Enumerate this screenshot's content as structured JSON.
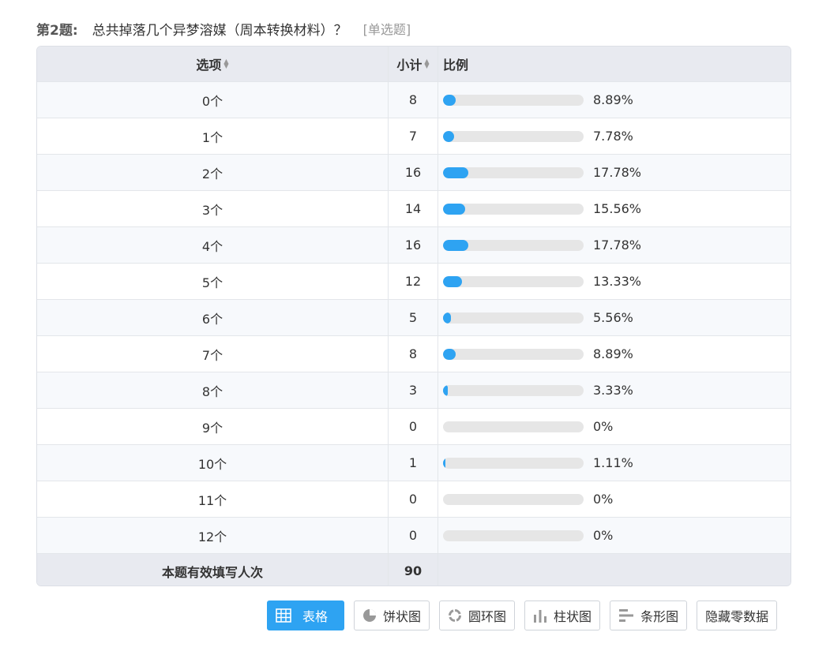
{
  "question": {
    "number": "第2题:",
    "text": "总共掉落几个异梦溶媒（周本转换材料）？",
    "type": "[单选题]"
  },
  "table": {
    "headers": {
      "option": "选项",
      "count": "小计",
      "ratio": "比例"
    },
    "rows": [
      {
        "option": "0个",
        "count": "8",
        "percent": "8.89%",
        "fraction": 0.0889
      },
      {
        "option": "1个",
        "count": "7",
        "percent": "7.78%",
        "fraction": 0.0778
      },
      {
        "option": "2个",
        "count": "16",
        "percent": "17.78%",
        "fraction": 0.1778
      },
      {
        "option": "3个",
        "count": "14",
        "percent": "15.56%",
        "fraction": 0.1556
      },
      {
        "option": "4个",
        "count": "16",
        "percent": "17.78%",
        "fraction": 0.1778
      },
      {
        "option": "5个",
        "count": "12",
        "percent": "13.33%",
        "fraction": 0.1333
      },
      {
        "option": "6个",
        "count": "5",
        "percent": "5.56%",
        "fraction": 0.0556
      },
      {
        "option": "7个",
        "count": "8",
        "percent": "8.89%",
        "fraction": 0.0889
      },
      {
        "option": "8个",
        "count": "3",
        "percent": "3.33%",
        "fraction": 0.0333
      },
      {
        "option": "9个",
        "count": "0",
        "percent": "0%",
        "fraction": 0
      },
      {
        "option": "10个",
        "count": "1",
        "percent": "1.11%",
        "fraction": 0.0111
      },
      {
        "option": "11个",
        "count": "0",
        "percent": "0%",
        "fraction": 0
      },
      {
        "option": "12个",
        "count": "0",
        "percent": "0%",
        "fraction": 0
      }
    ],
    "footer": {
      "label": "本题有效填写人次",
      "total": "90"
    }
  },
  "toolbar": {
    "table_label": "表格",
    "pie_label": "饼状图",
    "donut_label": "圆环图",
    "column_label": "柱状图",
    "bar_label": "条形图",
    "hide_zero_label": "隐藏零数据"
  },
  "colors": {
    "accent": "#2ea3f2",
    "track": "#e6e6e6",
    "header_bg": "#e8eaf0"
  },
  "icons": {
    "table": "table-grid-icon",
    "pie": "pie-chart-icon",
    "donut": "donut-chart-icon",
    "column": "column-chart-icon",
    "bar": "bar-chart-icon",
    "sort": "sort-icon"
  }
}
